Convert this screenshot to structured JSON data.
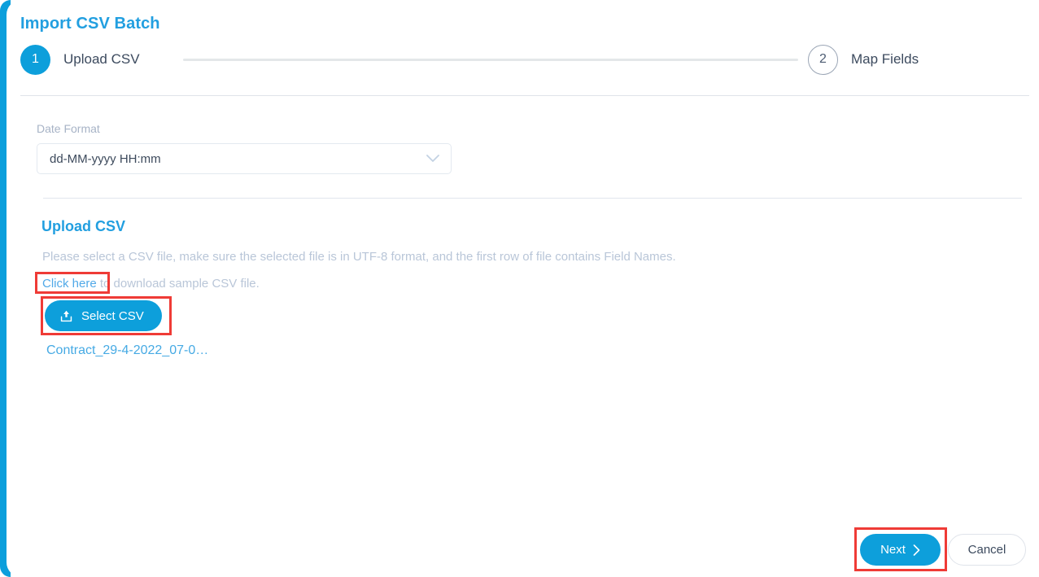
{
  "dialog": {
    "title": "Import CSV Batch"
  },
  "stepper": {
    "steps": [
      {
        "number": "1",
        "label": "Upload CSV",
        "state": "active"
      },
      {
        "number": "2",
        "label": "Map Fields",
        "state": "inactive"
      }
    ]
  },
  "date_format": {
    "label": "Date Format",
    "value": "dd-MM-yyyy HH:mm",
    "chevron_icon": "chevron-down-icon"
  },
  "upload": {
    "heading": "Upload CSV",
    "description": "Please select a CSV file, make sure the selected file is in UTF-8 format, and the first row of file contains Field Names.",
    "sample_link_text": "Click here",
    "sample_rest_text": " to download sample CSV file.",
    "select_button_label": "Select CSV",
    "select_button_icon": "upload-icon",
    "selected_file_name": "Contract_29-4-2022_07-0…"
  },
  "footer": {
    "next_label": "Next",
    "next_icon": "chevron-right-icon",
    "cancel_label": "Cancel"
  },
  "colors": {
    "accent_blue": "#0d9fdb",
    "title_blue": "#229fe0",
    "link_blue": "#46aae4",
    "muted_text": "#b9c6d8",
    "dark_text": "#3c4a5e",
    "annotation_red": "#ef3b36",
    "divider": "#dfe3ea"
  }
}
